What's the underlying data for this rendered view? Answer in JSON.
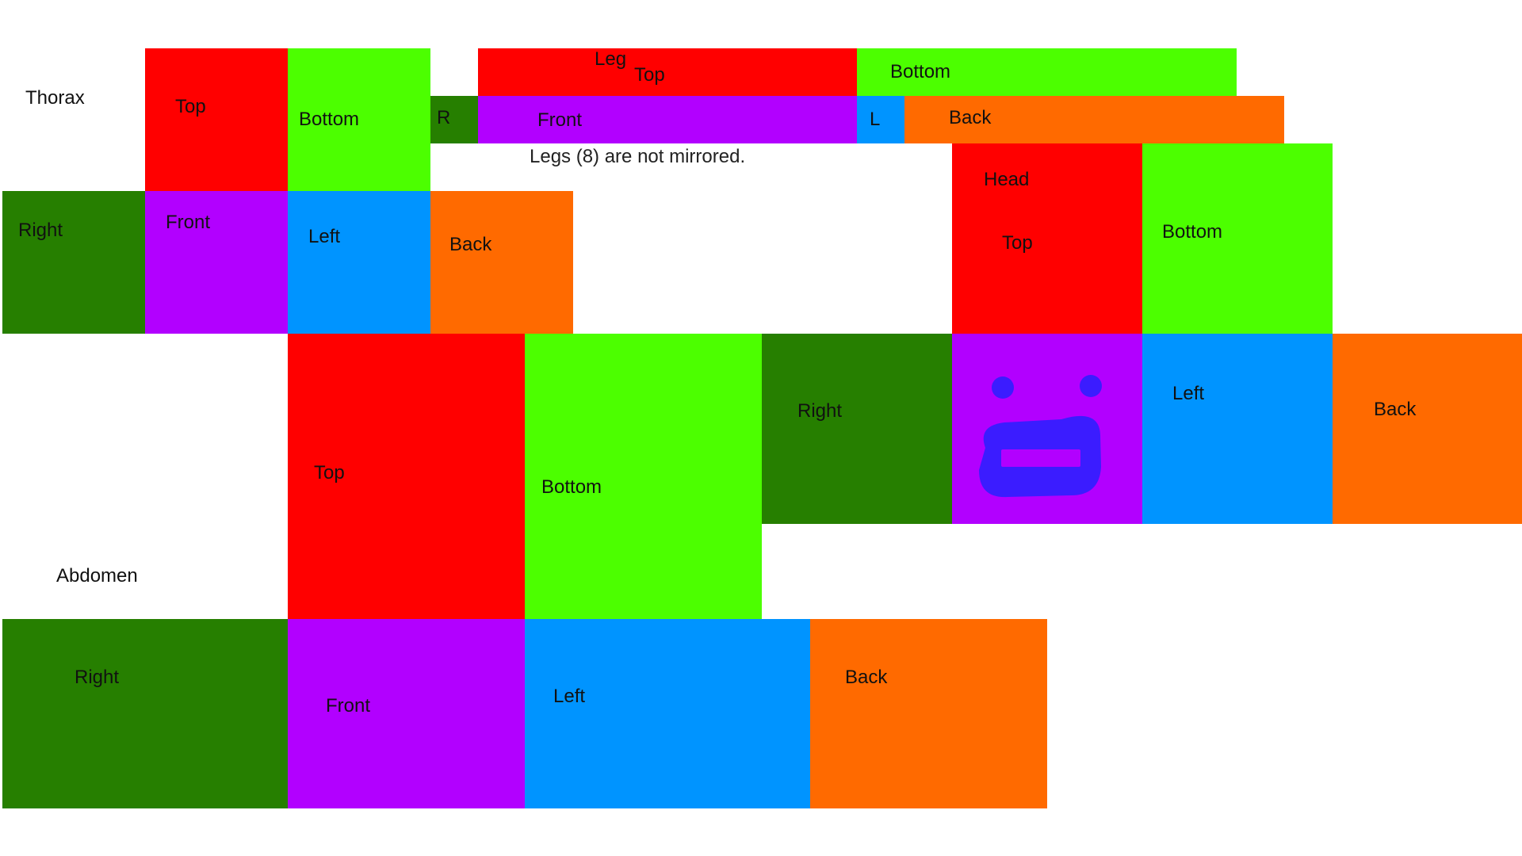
{
  "colors": {
    "top": "#ff0000",
    "bottom": "#4cff00",
    "right": "#267f00",
    "front": "#b200ff",
    "left": "#0094ff",
    "back": "#ff6a00",
    "face_paint": "#3b1cff"
  },
  "thorax": {
    "title": "Thorax",
    "top": "Top",
    "bottom": "Bottom",
    "right": "Right",
    "front": "Front",
    "left": "Left",
    "back": "Back"
  },
  "leg": {
    "title": "Leg",
    "top": "Top",
    "bottom": "Bottom",
    "right": "R",
    "front": "Front",
    "left": "L",
    "back": "Back",
    "note": "Legs (8) are not mirrored."
  },
  "head": {
    "title": "Head",
    "top": "Top",
    "bottom": "Bottom",
    "right": "Right",
    "front_icon": "smiley-face-icon",
    "left": "Left",
    "back": "Back"
  },
  "abdomen": {
    "title": "Abdomen",
    "top": "Top",
    "bottom": "Bottom",
    "right": "Right",
    "front": "Front",
    "left": "Left",
    "back": "Back"
  }
}
